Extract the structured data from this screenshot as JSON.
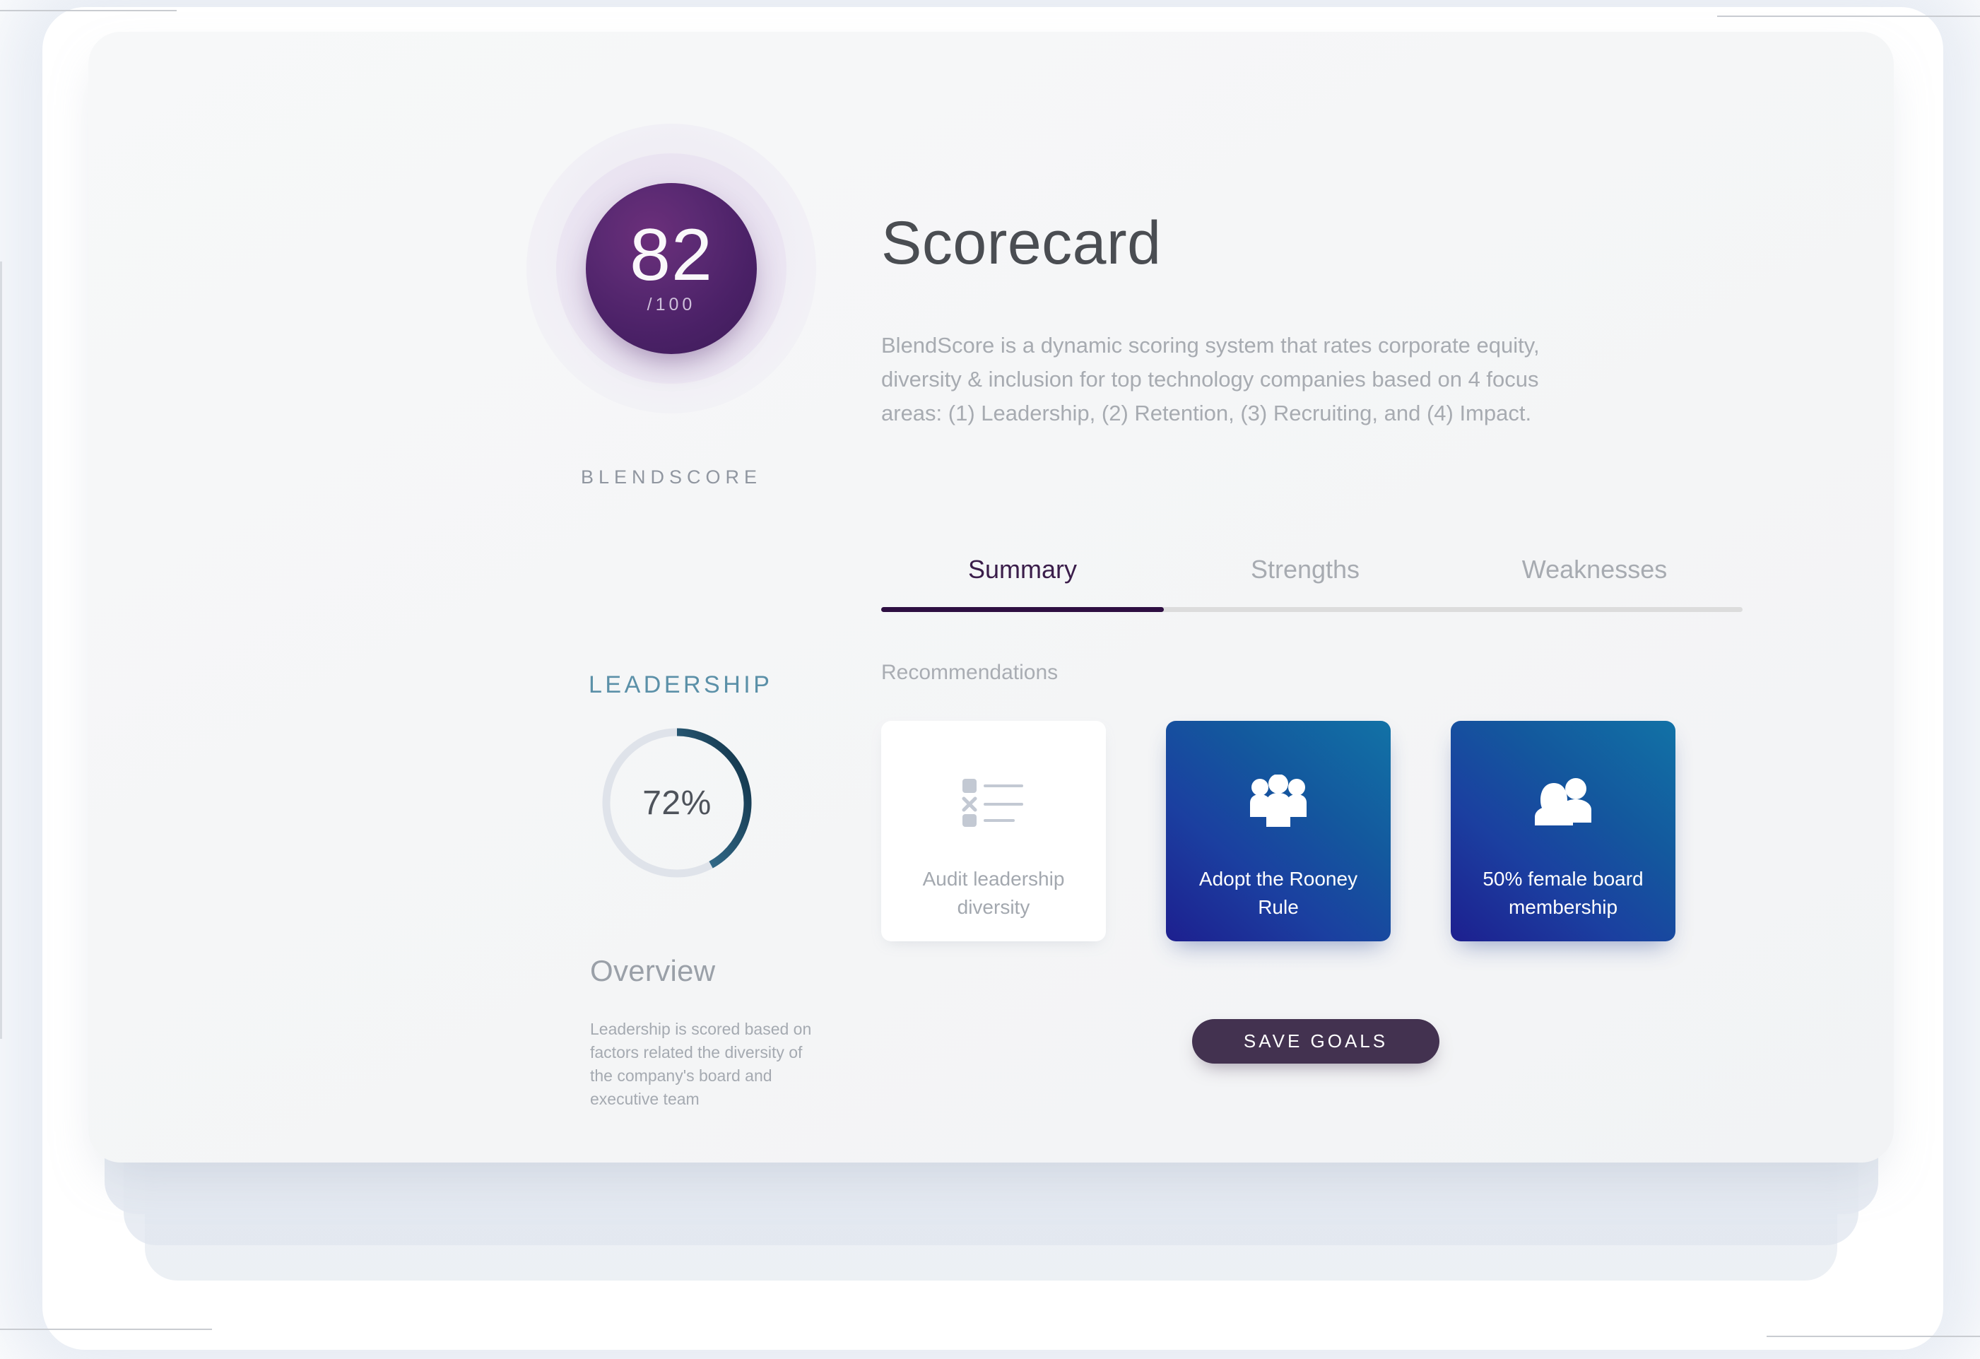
{
  "score_orb": {
    "value": "82",
    "max_label": "/100",
    "caption": "BLENDSCORE"
  },
  "header": {
    "title": "Scorecard",
    "description": "BlendScore is a dynamic scoring system that rates corporate equity, diversity & inclusion for top technology companies based on 4 focus areas: (1) Leadership, (2) Retention, (3) Recruiting, and (4) Impact."
  },
  "tabs": [
    {
      "label": "Summary",
      "active": true
    },
    {
      "label": "Strengths",
      "active": false
    },
    {
      "label": "Weaknesses",
      "active": false
    }
  ],
  "category": {
    "title": "LEADERSHIP",
    "percent_label": "72%",
    "percent_value": 72,
    "overview_title": "Overview",
    "overview_body": "Leadership is scored based on factors related the diversity of the company's board and executive team"
  },
  "recommendations": {
    "label": "Recommendations",
    "items": [
      {
        "label": "Audit leadership diversity",
        "icon": "checklist-icon",
        "selected": false
      },
      {
        "label": "Adopt the Rooney Rule",
        "icon": "people-group-icon",
        "selected": true
      },
      {
        "label": "50% female board membership",
        "icon": "people-pair-icon",
        "selected": true
      }
    ]
  },
  "actions": {
    "save_label": "SAVE GOALS"
  },
  "colors": {
    "accent_purple": "#2e0f42",
    "orb_purple": "#4b2167",
    "leadership_teal": "#5b90a8",
    "donut_start": "#4f87a4",
    "donut_end": "#143a54",
    "card_blue_start": "#1d1f8f",
    "card_blue_end": "#1272a6",
    "save_button": "#433250"
  }
}
